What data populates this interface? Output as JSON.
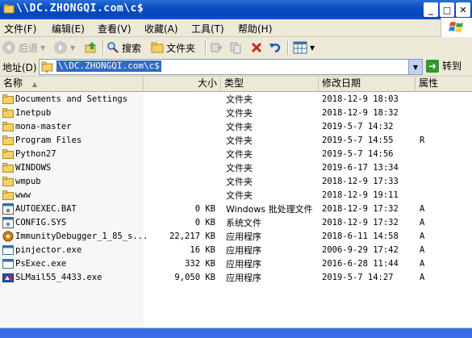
{
  "window": {
    "title": "\\\\DC.ZHONGQI.com\\c$",
    "minimize": "_",
    "maximize": "□",
    "close": "✕"
  },
  "menu": [
    "文件(F)",
    "编辑(E)",
    "查看(V)",
    "收藏(A)",
    "工具(T)",
    "帮助(H)"
  ],
  "toolbar": {
    "back": "后退",
    "search": "搜索",
    "folders": "文件夹"
  },
  "address": {
    "label": "地址(D)",
    "value": "\\\\DC.ZHONGQI.com\\c$",
    "go": "转到"
  },
  "columns": {
    "name": "名称",
    "size": "大小",
    "type": "类型",
    "modified": "修改日期",
    "attributes": "属性"
  },
  "files": [
    {
      "name": "Documents and Settings",
      "size": "",
      "type": "文件夹",
      "modified": "2018-12-9 18:03",
      "attr": "",
      "icon": "folder-icon"
    },
    {
      "name": "Inetpub",
      "size": "",
      "type": "文件夹",
      "modified": "2018-12-9 18:32",
      "attr": "",
      "icon": "folder-icon"
    },
    {
      "name": "mona-master",
      "size": "",
      "type": "文件夹",
      "modified": "2019-5-7 14:32",
      "attr": "",
      "icon": "folder-icon"
    },
    {
      "name": "Program Files",
      "size": "",
      "type": "文件夹",
      "modified": "2019-5-7 14:55",
      "attr": "R",
      "icon": "folder-icon"
    },
    {
      "name": "Python27",
      "size": "",
      "type": "文件夹",
      "modified": "2019-5-7 14:56",
      "attr": "",
      "icon": "folder-icon"
    },
    {
      "name": "WINDOWS",
      "size": "",
      "type": "文件夹",
      "modified": "2019-6-17 13:34",
      "attr": "",
      "icon": "folder-icon"
    },
    {
      "name": "wmpub",
      "size": "",
      "type": "文件夹",
      "modified": "2018-12-9 17:33",
      "attr": "",
      "icon": "folder-icon"
    },
    {
      "name": "www",
      "size": "",
      "type": "文件夹",
      "modified": "2018-12-9 19:11",
      "attr": "",
      "icon": "folder-icon"
    },
    {
      "name": "AUTOEXEC.BAT",
      "size": "0 KB",
      "type": "Windows 批处理文件",
      "modified": "2018-12-9 17:32",
      "attr": "A",
      "icon": "batch-file-icon"
    },
    {
      "name": "CONFIG.SYS",
      "size": "0 KB",
      "type": "系统文件",
      "modified": "2018-12-9 17:32",
      "attr": "A",
      "icon": "system-file-icon"
    },
    {
      "name": "ImmunityDebugger_1_85_s...",
      "size": "22,217 KB",
      "type": "应用程序",
      "modified": "2018-6-11 14:58",
      "attr": "A",
      "icon": "debugger-app-icon"
    },
    {
      "name": "pinjector.exe",
      "size": "16 KB",
      "type": "应用程序",
      "modified": "2006-9-29 17:42",
      "attr": "A",
      "icon": "exe-icon"
    },
    {
      "name": "PsExec.exe",
      "size": "332 KB",
      "type": "应用程序",
      "modified": "2016-6-28 11:44",
      "attr": "A",
      "icon": "exe-icon"
    },
    {
      "name": "SLMail55_4433.exe",
      "size": "9,050 KB",
      "type": "应用程序",
      "modified": "2019-5-7 14:27",
      "attr": "A",
      "icon": "installer-icon"
    }
  ]
}
